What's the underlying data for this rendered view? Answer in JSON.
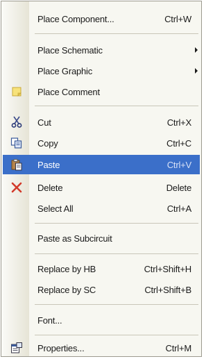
{
  "menu": {
    "place_component": {
      "label": "Place Component...",
      "shortcut": "Ctrl+W"
    },
    "place_schematic": {
      "label": "Place Schematic"
    },
    "place_graphic": {
      "label": "Place Graphic"
    },
    "place_comment": {
      "label": "Place Comment",
      "icon": "comment-icon"
    },
    "cut": {
      "label": "Cut",
      "shortcut": "Ctrl+X",
      "icon": "scissors-icon"
    },
    "copy": {
      "label": "Copy",
      "shortcut": "Ctrl+C",
      "icon": "copy-icon"
    },
    "paste": {
      "label": "Paste",
      "shortcut": "Ctrl+V",
      "icon": "paste-icon",
      "highlighted": true
    },
    "delete": {
      "label": "Delete",
      "shortcut": "Delete",
      "icon": "delete-icon"
    },
    "select_all": {
      "label": "Select All",
      "shortcut": "Ctrl+A"
    },
    "paste_as_subcircuit": {
      "label": "Paste as Subcircuit"
    },
    "replace_by_hb": {
      "label": "Replace by HB",
      "shortcut": "Ctrl+Shift+H"
    },
    "replace_by_sc": {
      "label": "Replace by SC",
      "shortcut": "Ctrl+Shift+B"
    },
    "font": {
      "label": "Font..."
    },
    "properties": {
      "label": "Properties...",
      "shortcut": "Ctrl+M",
      "icon": "properties-icon"
    }
  },
  "colors": {
    "menu_background": "#f7f7f1",
    "highlight": "#3b6fc9",
    "separator": "#c8c6b8",
    "delete_icon": "#d23a2a"
  }
}
